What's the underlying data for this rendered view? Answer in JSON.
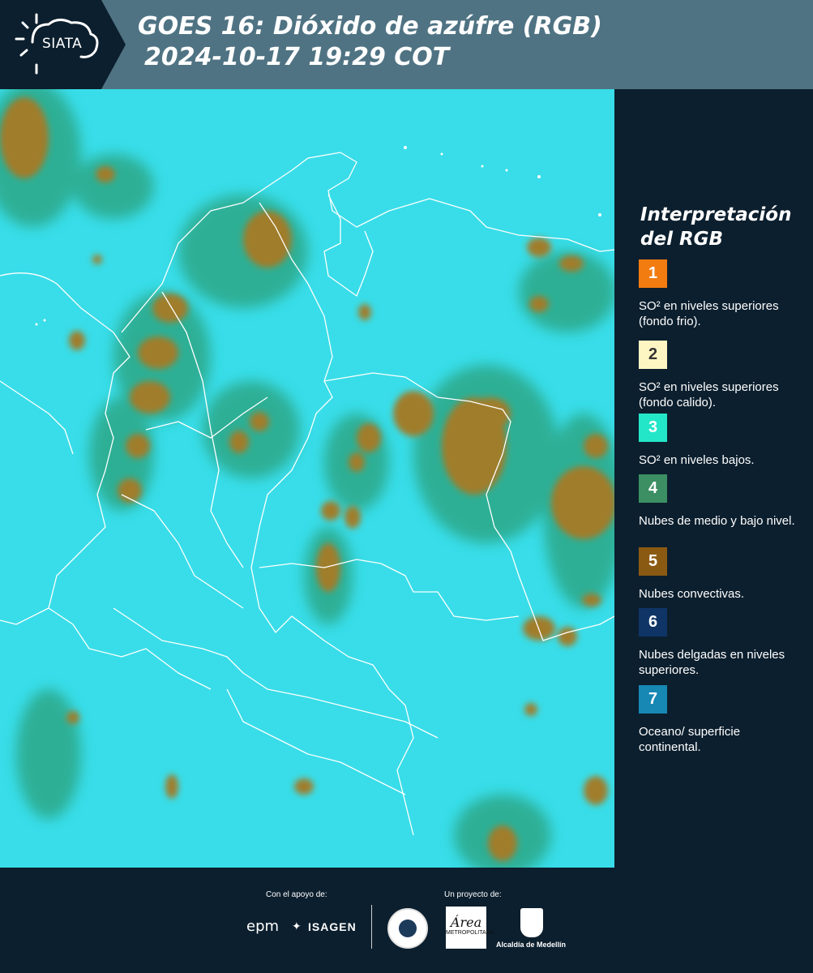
{
  "header": {
    "logo_text": "SIATA",
    "title_line1": "GOES 16: Dióxido de azúfre (RGB)",
    "title_line2": "2024-10-17 19:29 COT"
  },
  "map": {
    "background_color": "#35dde8",
    "cloud_color": "#9a7a2e",
    "vegetation_color": "#3e9f6a",
    "border_color": "#ffffff"
  },
  "legend": {
    "title_line1": "Interpretación",
    "title_line2": "del RGB",
    "items": [
      {
        "number": "1",
        "color": "#f27c10",
        "label": "SO² en niveles superiores (fondo frio)."
      },
      {
        "number": "2",
        "color": "#fdf6c3",
        "label": "SO² en niveles superiores (fondo calido)."
      },
      {
        "number": "3",
        "color": "#23e6c8",
        "label": "SO² en niveles bajos."
      },
      {
        "number": "4",
        "color": "#3b8f62",
        "label": "Nubes de medio y bajo nivel."
      },
      {
        "number": "5",
        "color": "#8b5a12",
        "label": "Nubes convectivas."
      },
      {
        "number": "6",
        "color": "#0f3566",
        "label": "Nubes delgadas en niveles superiores."
      },
      {
        "number": "7",
        "color": "#1787b4",
        "label": "Oceano/ superficie continental."
      }
    ]
  },
  "footer": {
    "support_label": "Con el apoyo de:",
    "project_label": "Un proyecto de:",
    "epm": "epm",
    "isagen": "ISAGEN",
    "amva_main": "Área",
    "amva_sub": "METROPOLITANA",
    "alcaldia": "Alcaldía de Medellín"
  }
}
